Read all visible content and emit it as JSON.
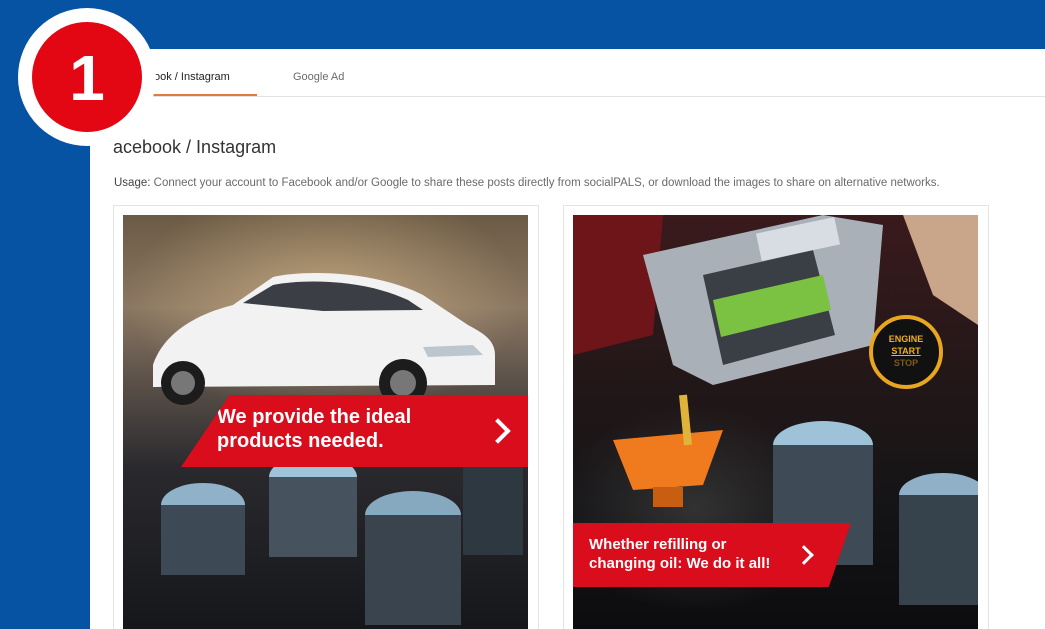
{
  "step_badge": {
    "number": "1"
  },
  "tabs": [
    {
      "label": "Facebook / Instagram",
      "visible_label": "ook / Instagram",
      "active": true
    },
    {
      "label": "Google Ad",
      "active": false
    }
  ],
  "section": {
    "title": "Facebook / Instagram",
    "visible_title": "acebook / Instagram"
  },
  "usage": {
    "label": "Usage:",
    "text": "Connect your account to Facebook and/or Google to share these posts directly from socialPALS, or download the images to share on alternative networks."
  },
  "posts": [
    {
      "image_icon": "car-and-pistons-image",
      "banner_line1": "We provide the ideal",
      "banner_line2": "products needed."
    },
    {
      "image_icon": "motor-oil-and-pistons-image",
      "banner_line1": "Whether refilling or",
      "banner_line2": "changing oil: We do it all!",
      "engine_button": {
        "line1": "ENGINE",
        "line2": "START",
        "line3": "STOP"
      }
    }
  ],
  "colors": {
    "background": "#0652a3",
    "badge_red": "#e30613",
    "banner_red": "#d90d1c",
    "tab_accent": "#e27a3f"
  }
}
